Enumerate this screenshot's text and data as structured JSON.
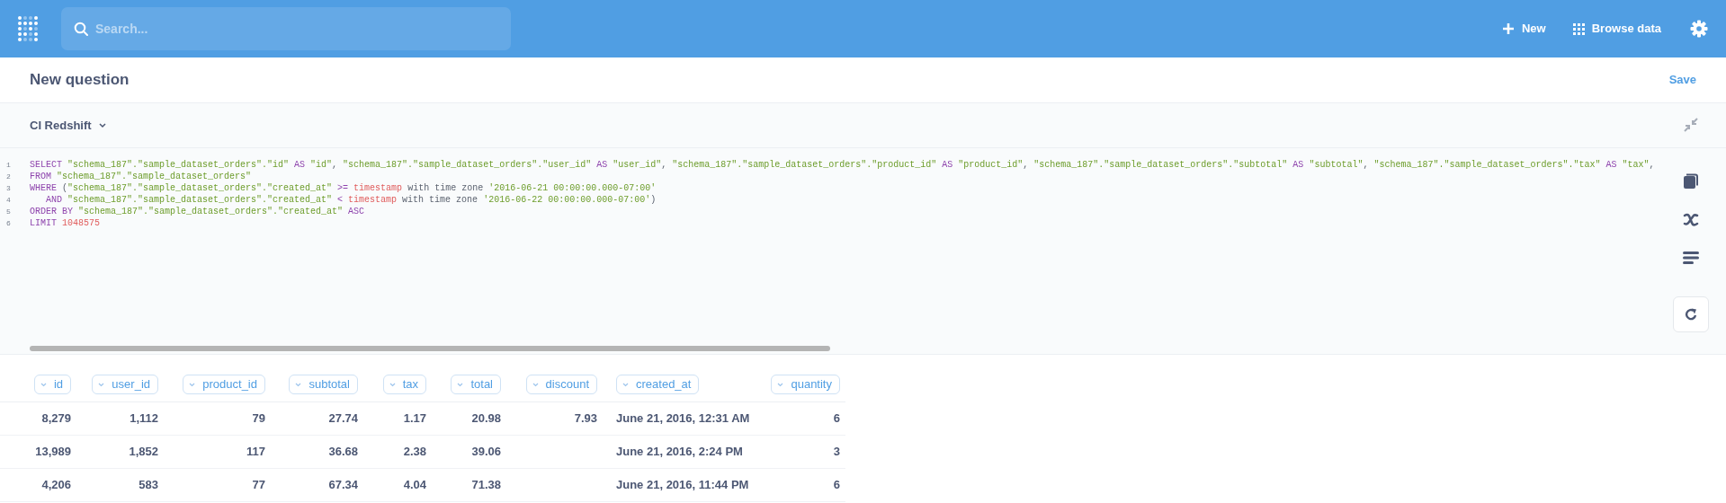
{
  "nav": {
    "search": {
      "placeholder": "Search..."
    },
    "actions": [
      {
        "label": "New"
      },
      {
        "label": "Browse data"
      }
    ]
  },
  "question": {
    "title": "New question",
    "save": "Save"
  },
  "database": {
    "name": "CI Redshift"
  },
  "editor": {
    "lines": [
      {
        "number": "1",
        "tokens": [
          {
            "kind": "kw",
            "text": "SELECT "
          },
          {
            "kind": "str",
            "text": "\"schema_187\".\"sample_dataset_orders\".\"id\""
          },
          {
            "kind": "kw",
            "text": " AS "
          },
          {
            "kind": "str",
            "text": "\"id\""
          },
          {
            "kind": "plain",
            "text": ", "
          },
          {
            "kind": "str",
            "text": "\"schema_187\".\"sample_dataset_orders\".\"user_id\""
          },
          {
            "kind": "kw",
            "text": " AS "
          },
          {
            "kind": "str",
            "text": "\"user_id\""
          },
          {
            "kind": "plain",
            "text": ", "
          },
          {
            "kind": "str",
            "text": "\"schema_187\".\"sample_dataset_orders\".\"product_id\""
          },
          {
            "kind": "kw",
            "text": " AS "
          },
          {
            "kind": "str",
            "text": "\"product_id\""
          },
          {
            "kind": "plain",
            "text": ", "
          },
          {
            "kind": "str",
            "text": "\"schema_187\".\"sample_dataset_orders\".\"subtotal\""
          },
          {
            "kind": "kw",
            "text": " AS "
          },
          {
            "kind": "str",
            "text": "\"subtotal\""
          },
          {
            "kind": "plain",
            "text": ", "
          },
          {
            "kind": "str",
            "text": "\"schema_187\".\"sample_dataset_orders\".\"tax\""
          },
          {
            "kind": "kw",
            "text": " AS "
          },
          {
            "kind": "str",
            "text": "\"tax\""
          },
          {
            "kind": "plain",
            "text": ","
          }
        ]
      },
      {
        "number": "2",
        "tokens": [
          {
            "kind": "kw",
            "text": "FROM "
          },
          {
            "kind": "str",
            "text": "\"schema_187\".\"sample_dataset_orders\""
          }
        ]
      },
      {
        "number": "3",
        "tokens": [
          {
            "kind": "kw",
            "text": "WHERE "
          },
          {
            "kind": "plain",
            "text": "("
          },
          {
            "kind": "str",
            "text": "\"schema_187\".\"sample_dataset_orders\".\"created_at\""
          },
          {
            "kind": "kw",
            "text": " >= "
          },
          {
            "kind": "lit",
            "text": "timestamp"
          },
          {
            "kind": "plain",
            "text": " with time zone "
          },
          {
            "kind": "str",
            "text": "'2016-06-21 00:00:00.000-07:00'"
          }
        ]
      },
      {
        "number": "4",
        "tokens": [
          {
            "kind": "kw",
            "text": "   AND "
          },
          {
            "kind": "str",
            "text": "\"schema_187\".\"sample_dataset_orders\".\"created_at\""
          },
          {
            "kind": "kw",
            "text": " < "
          },
          {
            "kind": "lit",
            "text": "timestamp"
          },
          {
            "kind": "plain",
            "text": " with time zone "
          },
          {
            "kind": "str",
            "text": "'2016-06-22 00:00:00.000-07:00'"
          },
          {
            "kind": "plain",
            "text": ")"
          }
        ]
      },
      {
        "number": "5",
        "tokens": [
          {
            "kind": "kw",
            "text": "ORDER BY "
          },
          {
            "kind": "str",
            "text": "\"schema_187\".\"sample_dataset_orders\".\"created_at\""
          },
          {
            "kind": "kw",
            "text": " ASC"
          }
        ]
      },
      {
        "number": "6",
        "tokens": [
          {
            "kind": "kw",
            "text": "LIMIT "
          },
          {
            "kind": "lit",
            "text": "1048575"
          }
        ]
      }
    ]
  },
  "table": {
    "columns": [
      {
        "label": "id",
        "kind": "number"
      },
      {
        "label": "user_id",
        "kind": "number"
      },
      {
        "label": "product_id",
        "kind": "number"
      },
      {
        "label": "subtotal",
        "kind": "number"
      },
      {
        "label": "tax",
        "kind": "number"
      },
      {
        "label": "total",
        "kind": "number"
      },
      {
        "label": "discount",
        "kind": "number"
      },
      {
        "label": "created_at",
        "kind": "datetime"
      },
      {
        "label": "quantity",
        "kind": "number"
      }
    ],
    "rows": [
      [
        "8,279",
        "1,112",
        "79",
        "27.74",
        "1.17",
        "20.98",
        "7.93",
        "June 21, 2016, 12:31 AM",
        "6"
      ],
      [
        "13,989",
        "1,852",
        "117",
        "36.68",
        "2.38",
        "39.06",
        null,
        "June 21, 2016, 2:24 PM",
        "3"
      ],
      [
        "4,206",
        "583",
        "77",
        "67.34",
        "4.04",
        "71.38",
        null,
        "June 21, 2016, 11:44 PM",
        "6"
      ]
    ]
  }
}
